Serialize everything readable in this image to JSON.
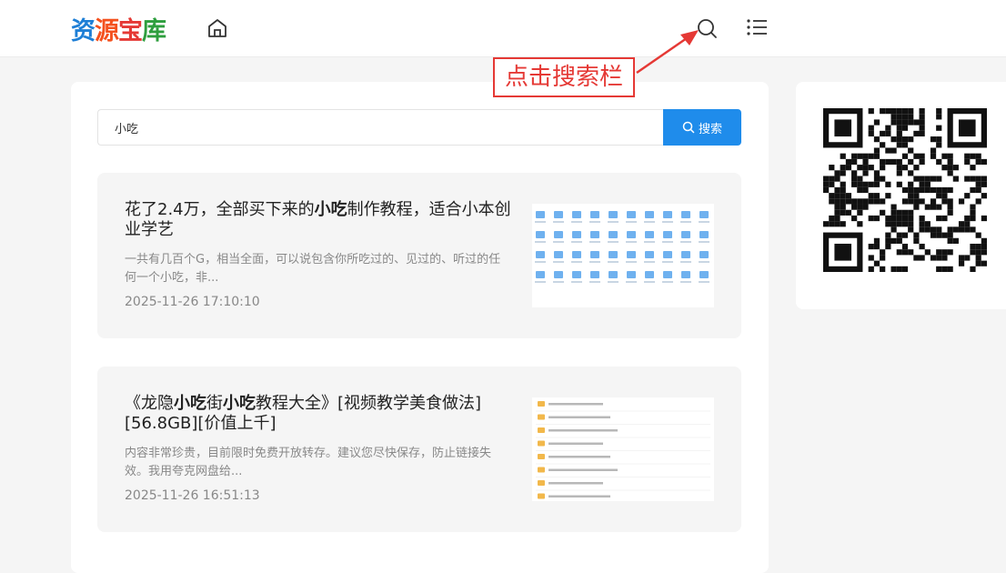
{
  "header": {
    "logo_chars": [
      {
        "char": "资",
        "color": "#1e7fd6"
      },
      {
        "char": "源",
        "color": "#f4511e"
      },
      {
        "char": "宝",
        "color": "#e53935"
      },
      {
        "char": "库",
        "color": "#2e9e3e"
      }
    ],
    "icons": {
      "home": "home-icon",
      "search": "search-icon",
      "menu": "list-menu-icon"
    }
  },
  "annotation": {
    "text": "点击搜索栏",
    "color": "#e53935"
  },
  "search": {
    "value": "小吃",
    "button_label": "搜索",
    "button_color": "#1f8ceb"
  },
  "results": [
    {
      "title_parts": [
        {
          "text": "花了2.4万，全部买下来的",
          "bold": false
        },
        {
          "text": "小吃",
          "bold": true
        },
        {
          "text": "制作教程，适合小本创业学艺",
          "bold": false
        }
      ],
      "description": "一共有几百个G，相当全面，可以说包含你所吃过的、见过的、听过的任何一个小吃，非...",
      "date": "2025-11-26 17:10:10",
      "thumbnail": "folder-grid-screenshot"
    },
    {
      "title_parts": [
        {
          "text": "《龙隐",
          "bold": false
        },
        {
          "text": "小吃",
          "bold": true
        },
        {
          "text": "街",
          "bold": false
        },
        {
          "text": "小吃",
          "bold": true
        },
        {
          "text": "教程大全》[视频教学美食做法][56.8GB][价值上千]",
          "bold": false
        }
      ],
      "description": "内容非常珍贵，目前限时免费开放转存。建议您尽快保存，防止链接失效。我用夸克网盘给...",
      "date": "2025-11-26 16:51:13",
      "thumbnail": "folder-list-screenshot"
    }
  ],
  "sidebar": {
    "qr_code": "qr-code-image"
  }
}
